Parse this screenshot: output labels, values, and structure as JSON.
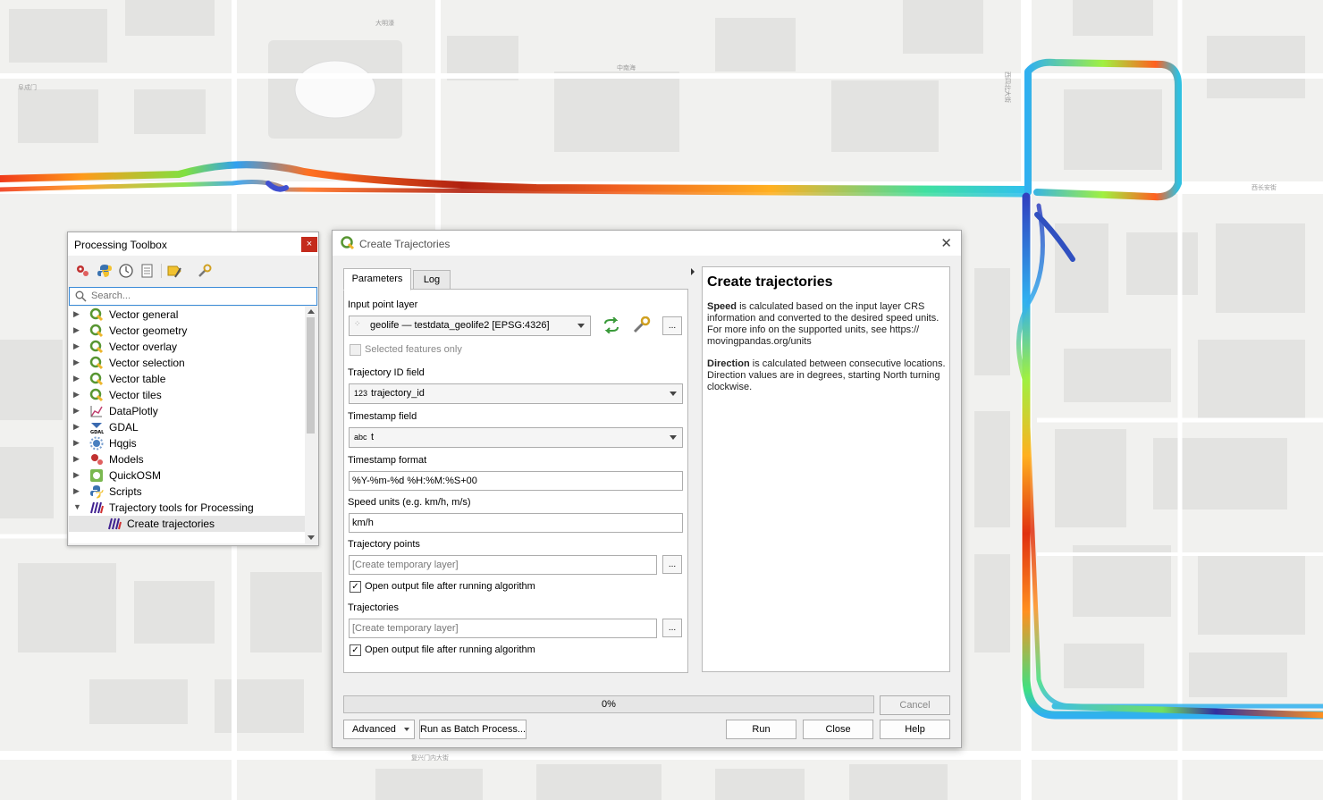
{
  "map": {
    "labels": [
      "大明濠",
      "西四北大街",
      "西长安街",
      "中南海",
      "阜成门",
      "复兴门内大街"
    ]
  },
  "toolbox": {
    "title": "Processing Toolbox",
    "close_label": "×",
    "search_placeholder": "Search...",
    "items": [
      {
        "label": "Vector general",
        "icon": "qgis-icon"
      },
      {
        "label": "Vector geometry",
        "icon": "qgis-icon"
      },
      {
        "label": "Vector overlay",
        "icon": "qgis-icon"
      },
      {
        "label": "Vector selection",
        "icon": "qgis-icon"
      },
      {
        "label": "Vector table",
        "icon": "qgis-icon"
      },
      {
        "label": "Vector tiles",
        "icon": "qgis-icon"
      },
      {
        "label": "DataPlotly",
        "icon": "dataplotly-icon"
      },
      {
        "label": "GDAL",
        "icon": "gdal-icon"
      },
      {
        "label": "Hqgis",
        "icon": "hqgis-icon"
      },
      {
        "label": "Models",
        "icon": "models-icon"
      },
      {
        "label": "QuickOSM",
        "icon": "quickosm-icon"
      },
      {
        "label": "Scripts",
        "icon": "python-icon"
      },
      {
        "label": "Trajectory tools for Processing",
        "icon": "trajectory-icon"
      }
    ],
    "child": {
      "label": "Create trajectories",
      "icon": "trajectory-icon"
    }
  },
  "dialog": {
    "title": "Create Trajectories",
    "tabs": [
      "Parameters",
      "Log"
    ],
    "input_layer_label": "Input point layer",
    "input_layer_value": "geolife — testdata_geolife2 [EPSG:4326]",
    "selected_only_label": "Selected features only",
    "traj_id_label": "Trajectory ID field",
    "traj_id_type": "123",
    "traj_id_value": "trajectory_id",
    "timestamp_label": "Timestamp field",
    "timestamp_type": "abc",
    "timestamp_value": "t",
    "timestamp_format_label": "Timestamp format",
    "timestamp_format_value": "%Y-%m-%d %H:%M:%S+00",
    "speed_units_label": "Speed units (e.g. km/h, m/s)",
    "speed_units_value": "km/h",
    "traj_points_label": "Trajectory points",
    "traj_points_placeholder": "[Create temporary layer]",
    "open_output_label": "Open output file after running algorithm",
    "trajectories_label": "Trajectories",
    "trajectories_placeholder": "[Create temporary layer]",
    "dots": "...",
    "help_title": "Create trajectories",
    "help_speed_bold": "Speed",
    "help_speed_text": " is calculated based on the input layer CRS information and converted to the desired speed units. For more info on the supported units, see https:// movingpandas.org/units",
    "help_dir_bold": "Direction",
    "help_dir_text": " is calculated between consecutive locations. Direction values are in degrees, starting North turning clockwise.",
    "progress": "0%",
    "cancel": "Cancel",
    "advanced": "Advanced",
    "batch": "Run as Batch Process...",
    "run": "Run",
    "close": "Close",
    "help": "Help"
  }
}
